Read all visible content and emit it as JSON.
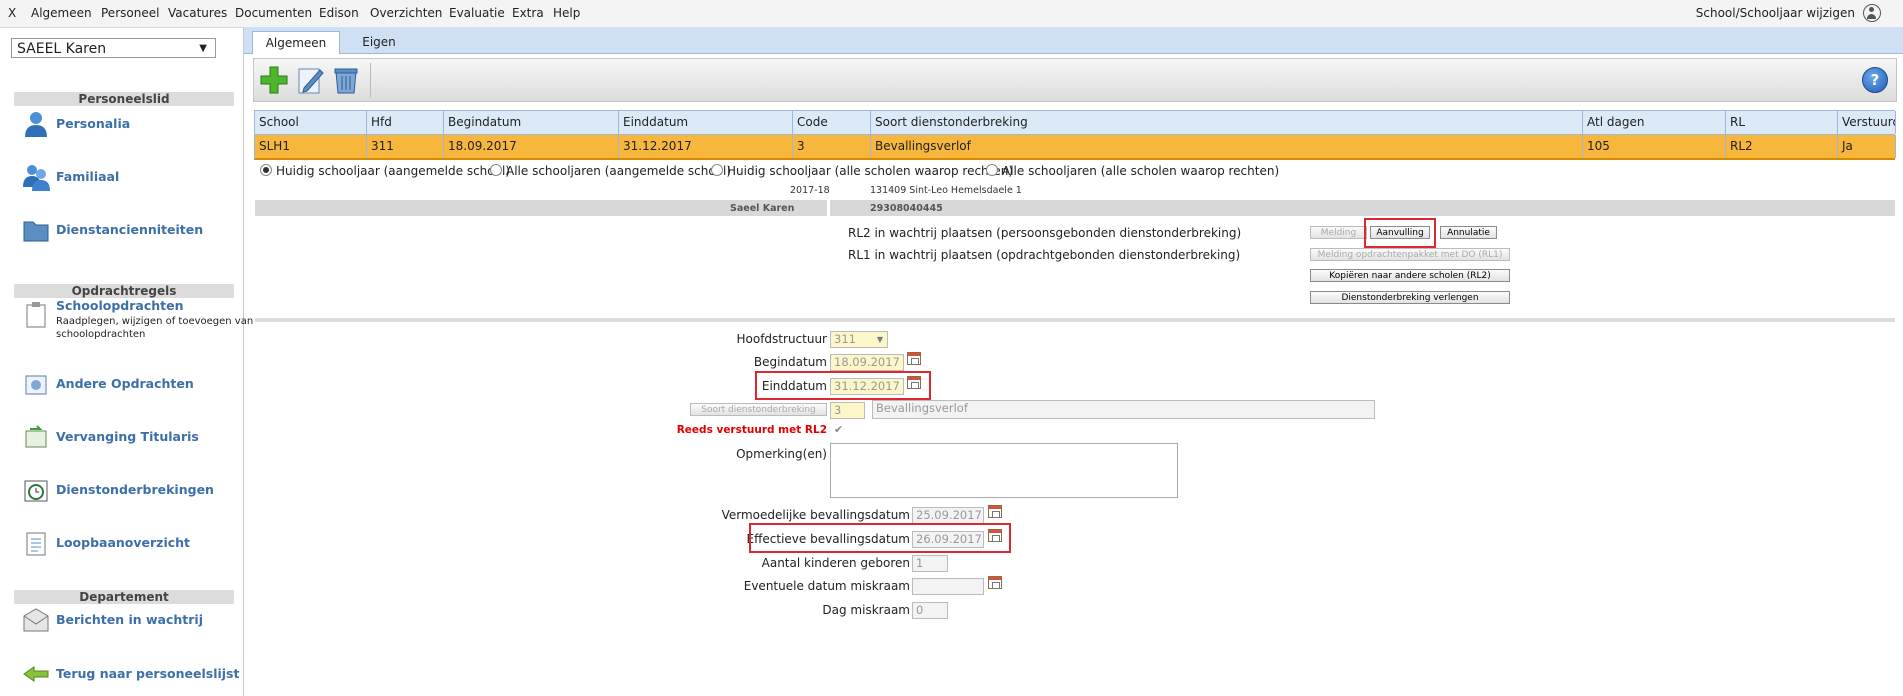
{
  "menu": {
    "items": [
      "X",
      "Algemeen",
      "Personeel",
      "Vacatures",
      "Documenten",
      "Edison",
      "Overzichten",
      "Evaluatie",
      "Extra",
      "Help"
    ],
    "right_label": "School/Schooljaar wijzigen"
  },
  "sidebar": {
    "selected_person": "SAEEL Karen",
    "section_personeelslid": "Personeelslid",
    "section_opdrachtregels": "Opdrachtregels",
    "section_departement": "Departement",
    "items": {
      "personalia": "Personalia",
      "familiaal": "Familiaal",
      "dienstanciënniteiten": "Dienstancienniteiten",
      "schoolopdrachten": "Schoolopdrachten",
      "schoolopdrachten_sub": "Raadplegen, wijzigen of toevoegen van schoolopdrachten",
      "andere_opdrachten": "Andere Opdrachten",
      "vervanging_titularis": "Vervanging Titularis",
      "dienstonderbrekingen": "Dienstonderbrekingen",
      "loopbaanoverzicht": "Loopbaanoverzicht",
      "berichten": "Berichten in wachtrij",
      "terug": "Terug naar personeelslijst"
    }
  },
  "tabs": [
    "Algemeen",
    "Eigen"
  ],
  "toolbar": {
    "icons": [
      "add-icon",
      "edit-icon",
      "delete-icon",
      "help-icon"
    ],
    "help_label": "?"
  },
  "grid": {
    "headers": [
      "School",
      "Hfd",
      "Begindatum",
      "Einddatum",
      "Code",
      "Soort dienstonderbreking",
      "Atl dagen",
      "RL",
      "Verstuurd"
    ],
    "rows": [
      [
        "SLH1",
        "311",
        "18.09.2017",
        "31.12.2017",
        "3",
        "Bevallingsverlof",
        "105",
        "RL2",
        "Ja"
      ]
    ]
  },
  "filters": {
    "options": [
      "Huidig schooljaar (aangemelde school)",
      "Alle schooljaren (aangemelde school)",
      "Huidig schooljaar (alle scholen waarop rechten)",
      "Alle schooljaren (alle scholen waarop rechten)"
    ],
    "selected_index": 0
  },
  "info": {
    "schooljaar": "2017-18",
    "school": "131409 Sint-Leo Hemelsdaele 1",
    "person_name": "Saeel Karen",
    "person_nr": "29308040445"
  },
  "queue": {
    "rl2_text": "RL2 in wachtrij plaatsen (persoonsgebonden dienstonderbreking)",
    "rl1_text": "RL1 in wachtrij plaatsen (opdrachtgebonden dienstonderbreking)",
    "melding": "Melding",
    "aanvulling": "Aanvulling",
    "annulatie": "Annulatie",
    "melding_rl1": "Melding opdrachtenpakket met DO (RL1)",
    "kopieren": "Kopiëren naar andere scholen (RL2)",
    "verlengen": "Dienstonderbreking verlengen"
  },
  "form": {
    "hoofdstructuur_label": "Hoofdstructuur",
    "hoofdstructuur_value": "311",
    "begindatum_label": "Begindatum",
    "begindatum_value": "18.09.2017",
    "einddatum_label": "Einddatum",
    "einddatum_value": "31.12.2017",
    "soort_button": "Soort dienstonderbreking",
    "soort_code": "3",
    "soort_desc": "Bevallingsverlof",
    "reeds_label": "Reeds verstuurd met RL2",
    "reeds_checked": true,
    "opmerking_label": "Opmerking(en)",
    "opmerking_value": "",
    "vermoedelijke_label": "Vermoedelijke bevallingsdatum",
    "vermoedelijke_value": "25.09.2017",
    "effectieve_label": "Effectieve bevallingsdatum",
    "effectieve_value": "26.09.2017",
    "kinderen_label": "Aantal kinderen geboren",
    "kinderen_value": "1",
    "miskraam_datum_label": "Eventuele datum miskraam",
    "miskraam_datum_value": "",
    "dag_miskraam_label": "Dag miskraam",
    "dag_miskraam_value": "0"
  },
  "colors": {
    "selected_row": "#f6b73c",
    "header_blue": "#dce9f7",
    "link_blue": "#3d6fa8",
    "highlight_red": "#e0262e",
    "warning_red": "#e00000"
  }
}
